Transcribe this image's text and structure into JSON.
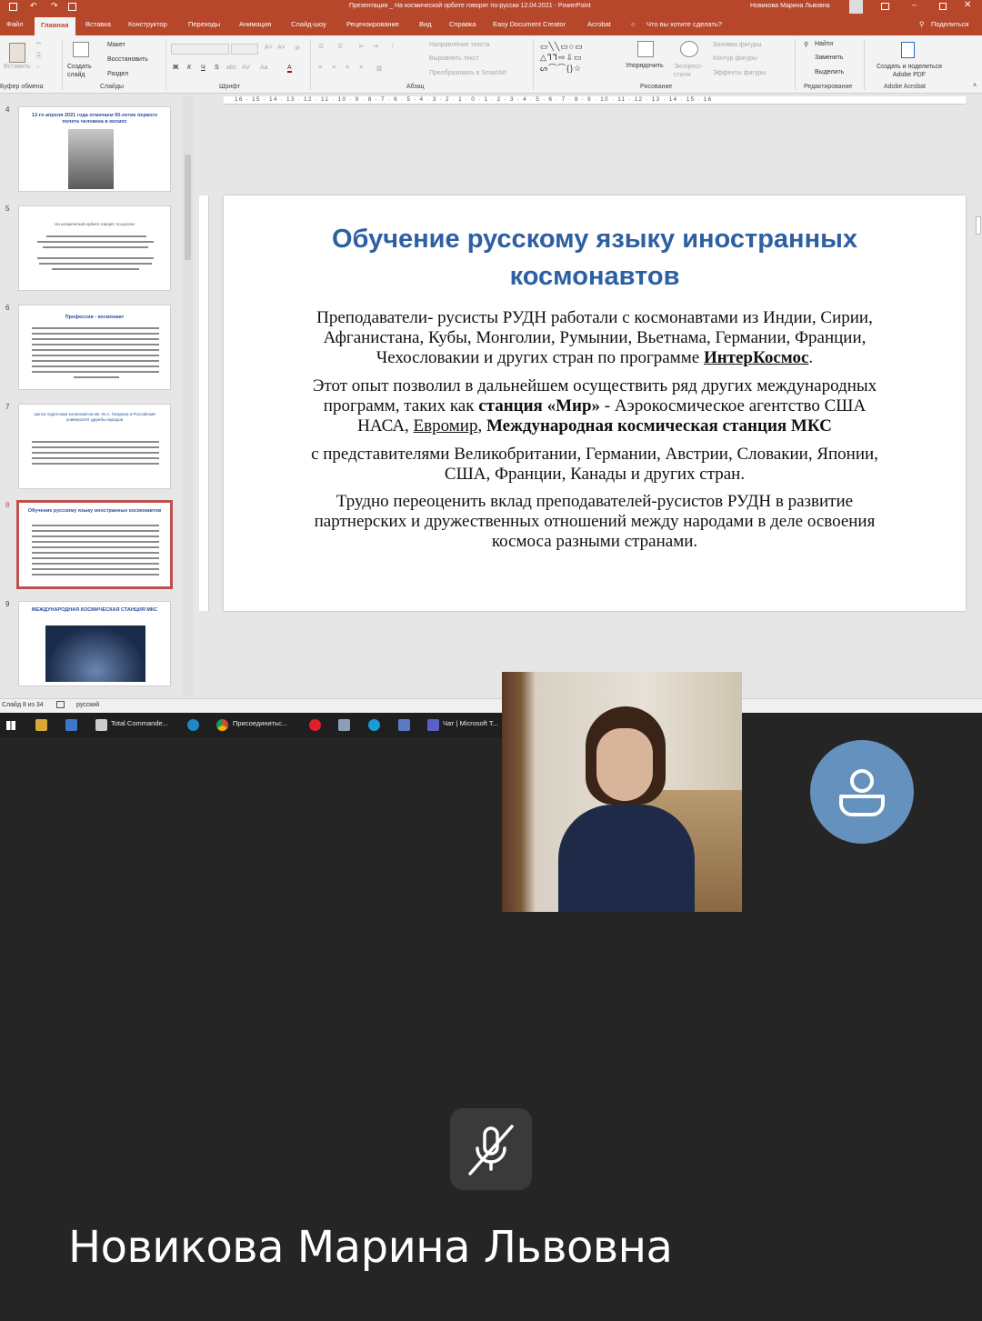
{
  "window": {
    "title": "Презентация _ На космической орбите говорят по-русски 12.04.2021  -  PowerPoint",
    "user": "Новикова Марина Львовна"
  },
  "tabs": [
    {
      "label": "Файл"
    },
    {
      "label": "Главная",
      "active": true
    },
    {
      "label": "Вставка"
    },
    {
      "label": "Конструктор"
    },
    {
      "label": "Переходы"
    },
    {
      "label": "Анимация"
    },
    {
      "label": "Слайд-шоу"
    },
    {
      "label": "Рецензирование"
    },
    {
      "label": "Вид"
    },
    {
      "label": "Справка"
    },
    {
      "label": "Easy Document Creator"
    },
    {
      "label": "Acrobat"
    }
  ],
  "tell_me": "Что вы хотите сделать?",
  "share": "Поделиться",
  "ribbon": {
    "paste": "Вставить",
    "new_slide": "Создать слайд",
    "layout": "Макет",
    "reset": "Восстановить",
    "section": "Раздел",
    "text_direction": "Направление текста",
    "align_text": "Выровнять текст",
    "smartart": "Преобразовать в SmartArt",
    "arrange": "Упорядочить",
    "quick_styles": "Экспресс-стили",
    "shape_fill": "Заливка фигуры",
    "shape_outline": "Контур фигуры",
    "shape_effects": "Эффекты фигуры",
    "find": "Найти",
    "replace": "Заменить",
    "select": "Выделить",
    "create_pdf": "Создать и поделиться Adobe PDF",
    "groups": {
      "clipboard": "Буфер обмена",
      "slides": "Слайды",
      "font": "Шрифт",
      "paragraph": "Абзац",
      "drawing": "Рисование",
      "editing": "Редактирование",
      "acrobat": "Adobe Acrobat"
    }
  },
  "ruler_labels": "16 · 15 · 14 · 13 · 12 · 11 · 10 · 9 · 8 · 7 · 6 · 5 · 4 · 3 · 2 · 1 · 0 · 1 · 2 · 3 · 4 · 5 · 6 · 7 · 8 · 9 · 10 · 11 · 12 · 13 · 14 · 15 · 16",
  "thumbnails": [
    {
      "num": "4",
      "title": "12-го апреля 2021 года отмечаем 60-летие первого полета человека в космос"
    },
    {
      "num": "5",
      "title": "На космической орбите говорят по-русски"
    },
    {
      "num": "6",
      "title": "Профессия - космонавт"
    },
    {
      "num": "7",
      "title": "Центр подготовки космонавтов им. Ю.А. Гагарина и Российский университет дружбы народов"
    },
    {
      "num": "8",
      "title": "Обучение русскому языку иностранных космонавтов",
      "selected": true
    },
    {
      "num": "9",
      "title": "МЕЖДУНАРОДНАЯ КОСМИЧЕСКАЯ СТАНЦИЯ МКС"
    }
  ],
  "slide": {
    "title_line1": "Обучение русскому языку иностранных",
    "title_line2": "космонавтов",
    "p1": {
      "l1": "Преподаватели- русисты  РУДН работали с космонавтами  из   Индии, Сирии,",
      "l2": "Афганистана, Кубы, Монголии, Румынии, Вьетнама, Германии, Франции,",
      "l3a": "Чехословакии и других стран по программе ",
      "l3b": "ИнтерКосмос",
      "l3c": "."
    },
    "p2": {
      "l1": "Этот опыт позволил в дальнейшем осуществить ряд других международных",
      "l2a": "программ, таких как ",
      "l2b": "станция «Мир»",
      "l2c": " - Аэрокосмическое агентство США",
      "l3a": "НАСА, ",
      "l3b": "Евромир",
      "l3c": ", ",
      "l3d": "Международная космическая станция МКС"
    },
    "p3": {
      "l1": "с представителями Великобритании, Германии, Австрии, Словакии, Японии,",
      "l2": "США, Франции, Канады и других стран."
    },
    "p4": {
      "l1": "Трудно переоценить вклад преподавателей-русистов РУДН в развитие",
      "l2": "партнерских и дружественных отношений между народами в деле освоения",
      "l3": "космоса разными странами."
    }
  },
  "status": {
    "slide_count": "Слайд 8 из 34",
    "language": "русский"
  },
  "taskbar": {
    "total_commander": "Total Commande...",
    "chrome": "Присоединитьс...",
    "teams": "Чат | Microsoft T..."
  },
  "call": {
    "participant_name": "Новикова Марина Львовна",
    "mic_muted": true
  }
}
